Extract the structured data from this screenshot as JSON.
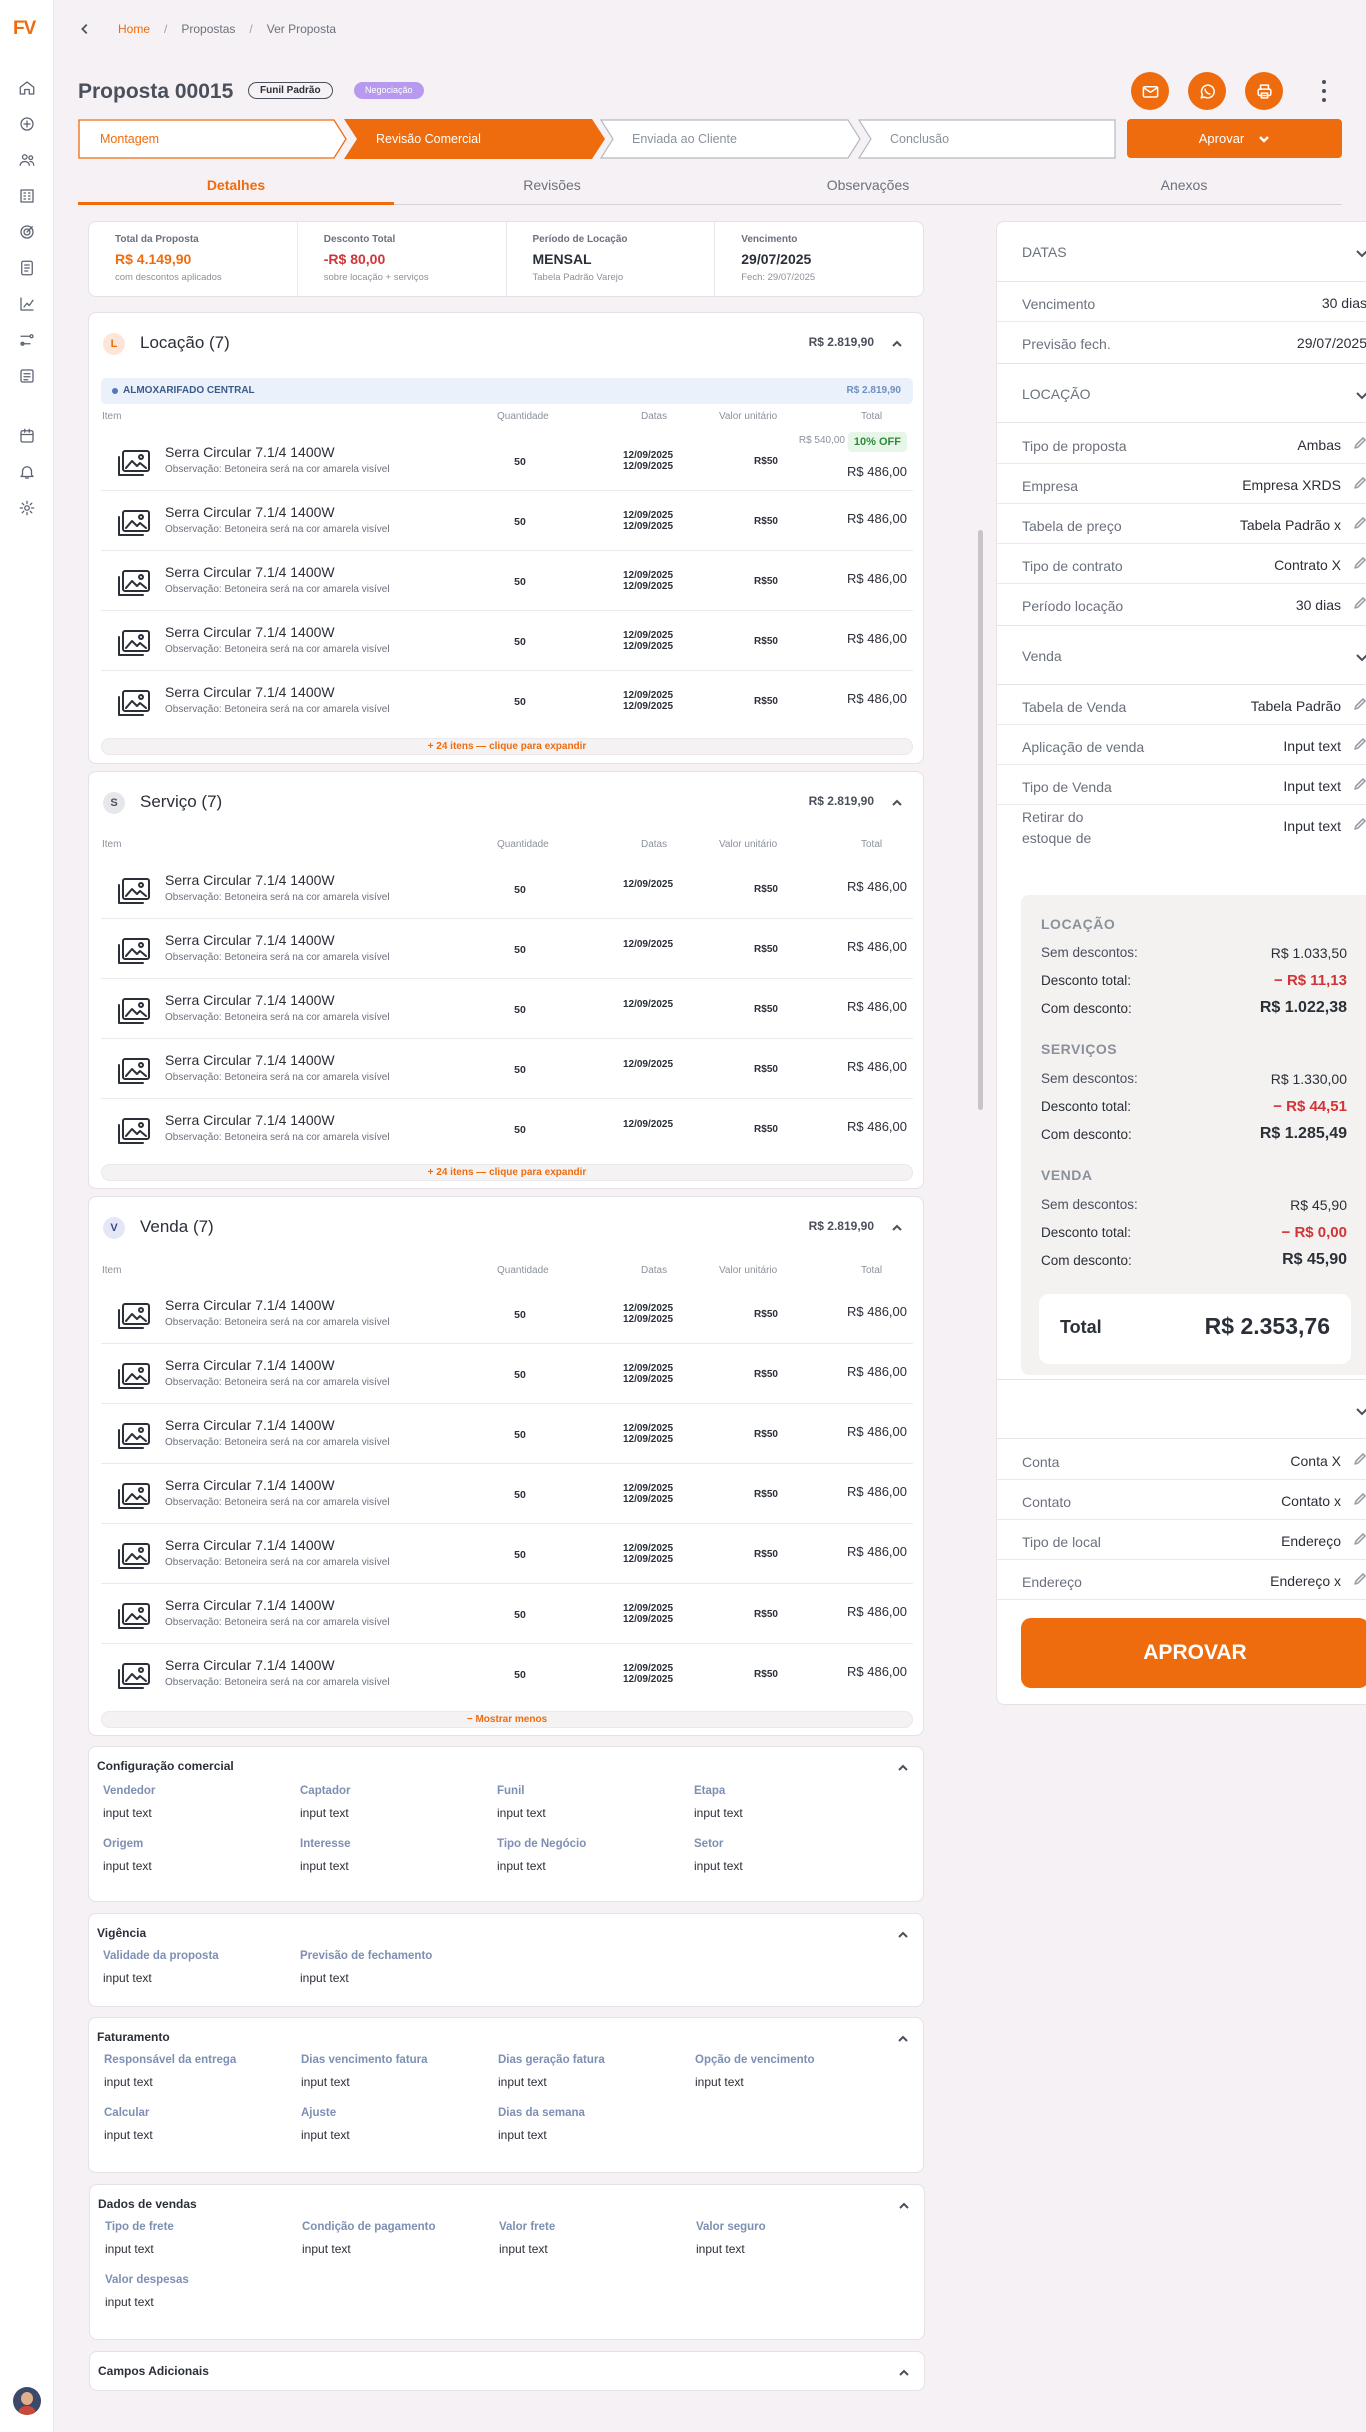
{
  "brand": {
    "logo": "FV",
    "accent": "#ef6c0e"
  },
  "sidebar": {
    "icons": [
      "home-icon",
      "headset-icon",
      "users-icon",
      "building-icon",
      "target-icon",
      "document-icon",
      "chart-icon",
      "route-icon",
      "list-icon",
      "calendar-icon",
      "bell-icon",
      "gear-icon"
    ]
  },
  "breadcrumb": {
    "home": "Home",
    "items": [
      "Propostas",
      "Ver Proposta"
    ]
  },
  "header": {
    "title": "Proposta 00015",
    "tag_funil": "Funil Padrão",
    "tag_status": "Negociação",
    "approve_label": "Aprovar"
  },
  "steps": [
    "Montagem",
    "Revisão Comercial",
    "Enviada ao Cliente",
    "Conclusão"
  ],
  "tabs": [
    "Detalhes",
    "Revisões",
    "Observações",
    "Anexos"
  ],
  "summary": [
    {
      "label": "Total da Proposta",
      "value": "R$ 4.149,90",
      "sub": "com descontos aplicados"
    },
    {
      "label": "Desconto Total",
      "value": "-R$ 80,00",
      "sub": "sobre locação + serviços"
    },
    {
      "label": "Período de Locação",
      "value": "MENSAL",
      "sub": "Tabela Padrão Varejo"
    },
    {
      "label": "Vencimento",
      "value": "29/07/2025",
      "sub": "Fech: 29/07/2025"
    }
  ],
  "columns": {
    "item": "Item",
    "qty": "Quantidade",
    "dates": "Datas",
    "unit": "Valor unitário",
    "total": "Total"
  },
  "item": {
    "name": "Serra Circular 7.1/4 1400W",
    "obs": "Observação: Betoneira será na cor amarela visível",
    "qty": "50",
    "date": "12/09/2025",
    "unit": "R$50",
    "total": "R$ 486,00",
    "orig": "R$ 540,00",
    "off": "10% OFF"
  },
  "sections": {
    "locacao": {
      "letter": "L",
      "title": "Locação (7)",
      "total": "R$ 2.819,90",
      "warehouse": "ALMOXARIFADO CENTRAL",
      "warehouse_total": "R$ 2.819,90",
      "expand": "+ 24 itens — clique para expandir"
    },
    "servico": {
      "letter": "S",
      "title": "Serviço (7)",
      "total": "R$ 2.819,90",
      "expand": "+ 24 itens — clique para expandir"
    },
    "venda": {
      "letter": "V",
      "title": "Venda (7)",
      "total": "R$ 2.819,90",
      "expand": "− Mostrar menos"
    }
  },
  "config": {
    "comercial": {
      "title": "Configuração comercial",
      "fields": [
        [
          "Vendedor",
          "input text"
        ],
        [
          "Captador",
          "input text"
        ],
        [
          "Funil",
          "input text"
        ],
        [
          "Etapa",
          "input text"
        ],
        [
          "Origem",
          "input text"
        ],
        [
          "Interesse",
          "input text"
        ],
        [
          "Tipo de Negócio",
          "input text"
        ],
        [
          "Setor",
          "input text"
        ]
      ]
    },
    "vigencia": {
      "title": "Vigência",
      "fields": [
        [
          "Validade da proposta",
          "input text"
        ],
        [
          "Previsão de fechamento",
          "input text"
        ]
      ]
    },
    "faturamento": {
      "title": "Faturamento",
      "fields": [
        [
          "Responsável da entrega",
          "input text"
        ],
        [
          "Dias vencimento fatura",
          "input text"
        ],
        [
          "Dias geração fatura",
          "input text"
        ],
        [
          "Opção de vencimento",
          "input text"
        ],
        [
          "Calcular",
          "input text"
        ],
        [
          "Ajuste",
          "input text"
        ],
        [
          "Dias da semana",
          "input text"
        ]
      ]
    },
    "vendas": {
      "title": "Dados de vendas",
      "fields": [
        [
          "Tipo de frete",
          "input text"
        ],
        [
          "Condição de pagamento",
          "input text"
        ],
        [
          "Valor frete",
          "input text"
        ],
        [
          "Valor seguro",
          "input text"
        ],
        [
          "Valor despesas",
          "input text"
        ]
      ]
    },
    "adicionais": {
      "title": "Campos Adicionais"
    }
  },
  "right": {
    "datas": {
      "title": "DATAS",
      "rows": [
        [
          "Vencimento",
          "30 dias"
        ],
        [
          "Previsão fech.",
          "29/07/2025"
        ]
      ]
    },
    "locacao": {
      "title": "LOCAÇÃO",
      "rows": [
        [
          "Tipo de proposta",
          "Ambas"
        ],
        [
          "Empresa",
          "Empresa XRDS"
        ],
        [
          "Tabela de preço",
          "Tabela Padrão x"
        ],
        [
          "Tipo de contrato",
          "Contrato X"
        ],
        [
          "Período locação",
          "30 dias"
        ]
      ]
    },
    "venda": {
      "title": "Venda",
      "rows": [
        [
          "Tabela de Venda",
          "Tabela Padrão"
        ],
        [
          "Aplicação de venda",
          "Input text"
        ],
        [
          "Tipo de Venda",
          "Input text"
        ],
        [
          "Retirar do estoque de",
          "Input text"
        ]
      ]
    },
    "totals": {
      "groups": [
        {
          "title": "LOCAÇÃO",
          "sem": "R$ 1.033,50",
          "desc": "− R$ 11,13",
          "com": "R$ 1.022,38"
        },
        {
          "title": "SERVIÇOS",
          "sem": "R$ 1.330,00",
          "desc": "− R$ 44,51",
          "com": "R$ 1.285,49"
        },
        {
          "title": "VENDA",
          "sem": "R$ 45,90",
          "desc": "− R$ 0,00",
          "com": "R$ 45,90"
        }
      ],
      "labels": {
        "sem": "Sem descontos:",
        "desc": "Desconto total:",
        "com": "Com desconto:"
      },
      "total_label": "Total",
      "total_value": "R$ 2.353,76"
    },
    "conta": {
      "rows": [
        [
          "Conta",
          "Conta X"
        ],
        [
          "Contato",
          "Contato x"
        ],
        [
          "Tipo de local",
          "Endereço"
        ],
        [
          "Endereço",
          "Endereço x"
        ]
      ]
    },
    "approve_label": "APROVAR"
  }
}
